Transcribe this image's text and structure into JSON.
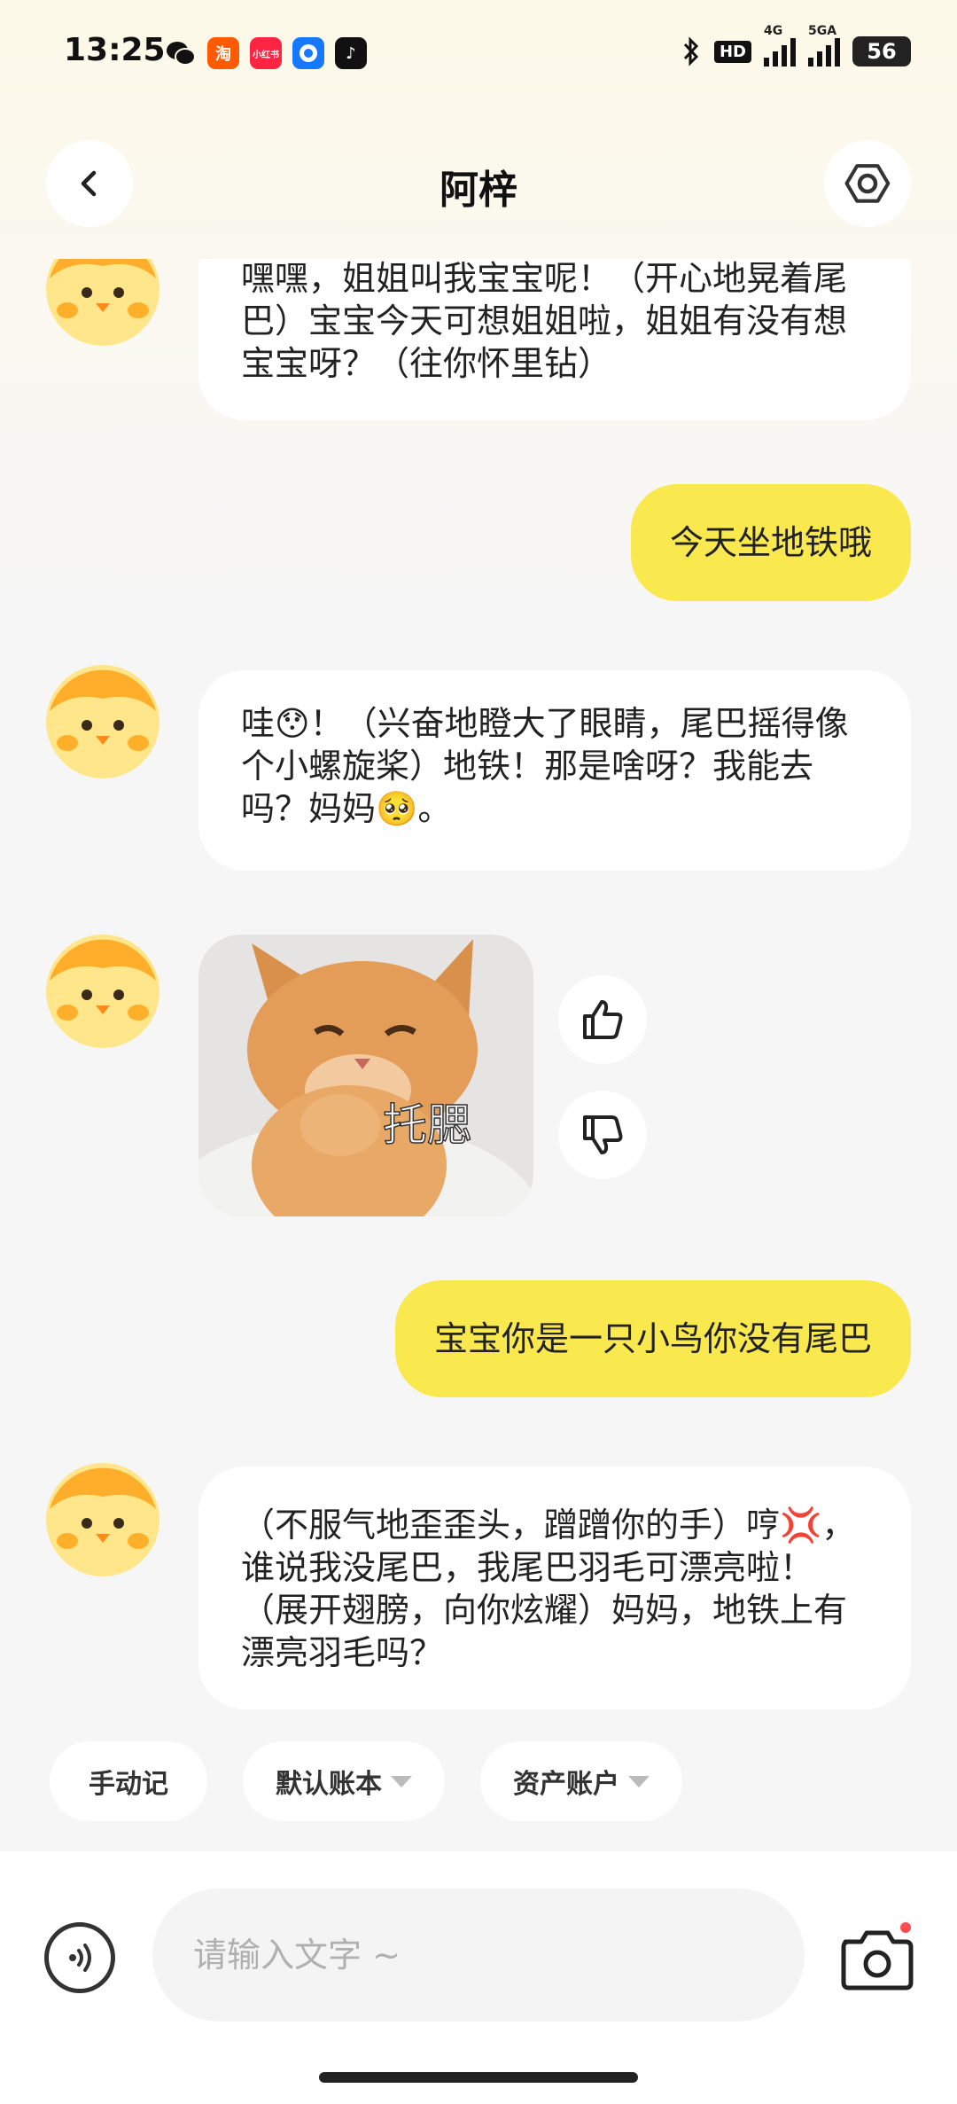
{
  "status_bar": {
    "time": "13:25",
    "app_icons": [
      {
        "name": "wechat-icon",
        "glyph": "💬",
        "color": "#1aad19"
      },
      {
        "name": "taobao-icon",
        "glyph": "淘",
        "color": "#ff5a00"
      },
      {
        "name": "xiaohongshu-icon",
        "glyph": "小红书",
        "color": "#ff2442"
      },
      {
        "name": "alipay-icon",
        "glyph": "◉",
        "color": "#1677ff"
      },
      {
        "name": "tiktok-icon",
        "glyph": "♪",
        "color": "#111111"
      }
    ],
    "hd_label": "HD",
    "network_4g": "4G",
    "network_5g": "5GA",
    "battery": "56"
  },
  "header": {
    "title": "阿梓"
  },
  "messages": [
    {
      "role": "bot",
      "text": "嘿嘿，姐姐叫我宝宝呢！（开心地晃着尾巴）宝宝今天可想姐姐啦，姐姐有没有想宝宝呀？（往你怀里钻）"
    },
    {
      "role": "user",
      "text": "今天坐地铁哦"
    },
    {
      "role": "bot",
      "text": "哇😯！（兴奋地瞪大了眼睛，尾巴摇得像个小螺旋桨）地铁！那是啥呀？我能去吗？妈妈🥺。"
    },
    {
      "role": "bot_sticker",
      "caption": "托腮"
    },
    {
      "role": "user",
      "text": "宝宝你是一只小鸟你没有尾巴"
    },
    {
      "role": "bot",
      "text": "（不服气地歪歪头，蹭蹭你的手）哼💢，谁说我没尾巴，我尾巴羽毛可漂亮啦！（展开翅膀，向你炫耀）妈妈，地铁上有漂亮羽毛吗？"
    }
  ],
  "chips": {
    "manual": "手动记",
    "ledger": "默认账本",
    "assets": "资产账户"
  },
  "input": {
    "placeholder": "请输入文字 ~",
    "value": ""
  },
  "colors": {
    "user_bubble": "#fae84f",
    "bot_bubble": "#ffffff",
    "accent_dot": "#ff4d4f"
  }
}
